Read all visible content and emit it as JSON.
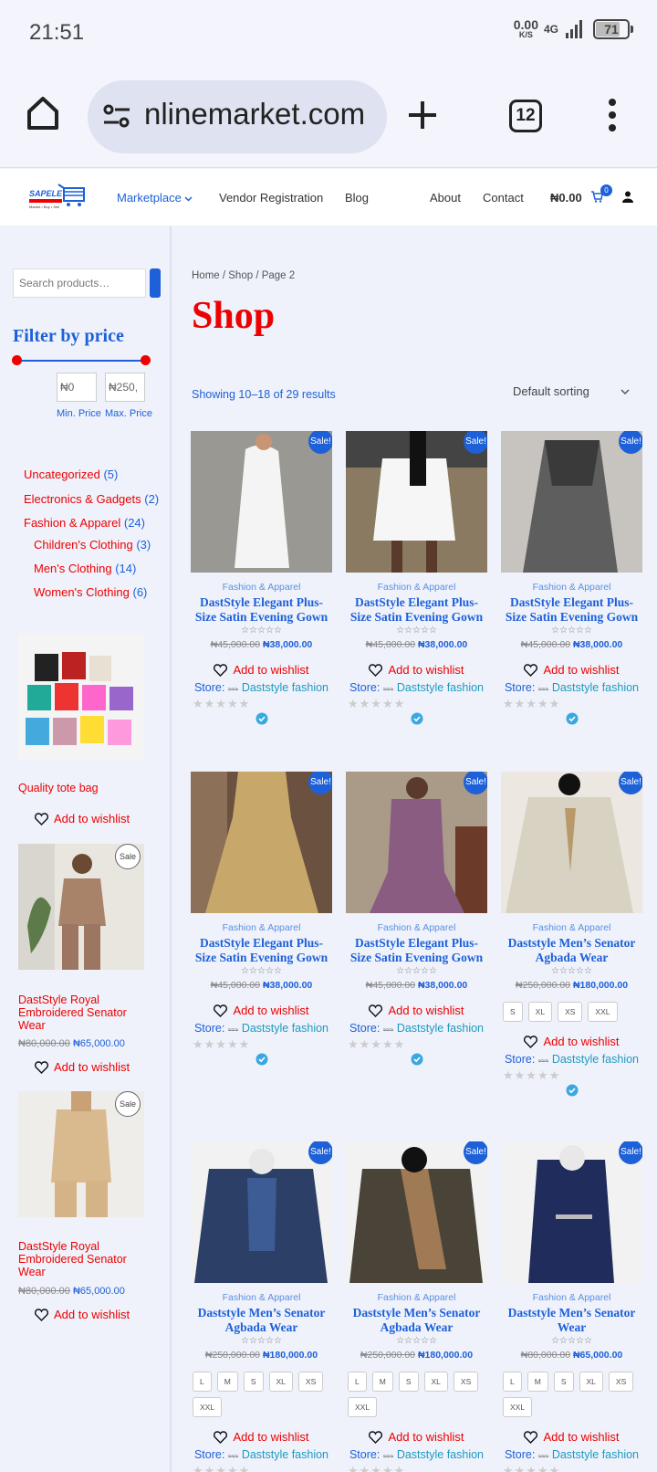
{
  "status": {
    "time": "21:51",
    "net_speed": "0.00",
    "net_unit": "K/S",
    "network": "4G",
    "battery": "71"
  },
  "browser": {
    "url": "nlinemarket.com",
    "tab_count": "12"
  },
  "header": {
    "nav": [
      "Marketplace",
      "Vendor Registration",
      "Blog",
      "About",
      "Contact"
    ],
    "cart_amount": "₦0.00",
    "cart_count": "0",
    "logo_text": "SAPELE ONLINE MARKET"
  },
  "sidebar": {
    "search_placeholder": "Search products…",
    "filter_title": "Filter by price",
    "min_value": "₦0",
    "max_value": "₦250,",
    "min_label": "Min. Price",
    "max_label": "Max. Price",
    "categories": [
      {
        "name": "Uncategorized",
        "count": "(5)"
      },
      {
        "name": "Electronics & Gadgets",
        "count": "(2)"
      },
      {
        "name": "Fashion & Apparel",
        "count": "(24)"
      },
      {
        "name": "Children's Clothing",
        "count": "(3)"
      },
      {
        "name": "Men's Clothing",
        "count": "(14)"
      },
      {
        "name": "Women's Clothing",
        "count": "(6)"
      }
    ],
    "products": [
      {
        "title": "Quality tote bag",
        "wishlist": "Add to wishlist"
      },
      {
        "title": "DastStyle Royal Embroidered Senator Wear",
        "old_price": "₦80,000.00",
        "price": "₦65,000.00",
        "badge": "Sale",
        "wishlist": "Add to wishlist"
      },
      {
        "title": "DastStyle Royal Embroidered Senator Wear",
        "old_price": "₦80,000.00",
        "price": "₦65,000.00",
        "badge": "Sale",
        "wishlist": "Add to wishlist"
      }
    ]
  },
  "content": {
    "breadcrumb": "Home / Shop / Page 2",
    "title": "Shop",
    "showing": "Showing 10–18 of 29 results",
    "sorting": "Default sorting",
    "products": [
      {
        "category": "Fashion & Apparel",
        "title": "DastStyle Elegant Plus-Size Satin Evening Gown",
        "old_price": "₦45,000.00",
        "price": "₦38,000.00",
        "badge": "Sale!",
        "wishlist": "Add to wishlist",
        "store_label": "Store:",
        "store": "Daststyle fashion"
      },
      {
        "category": "Fashion & Apparel",
        "title": "DastStyle Elegant Plus-Size Satin Evening Gown",
        "old_price": "₦45,000.00",
        "price": "₦38,000.00",
        "badge": "Sale!",
        "wishlist": "Add to wishlist",
        "store_label": "Store:",
        "store": "Daststyle fashion"
      },
      {
        "category": "Fashion & Apparel",
        "title": "DastStyle Elegant Plus-Size Satin Evening Gown",
        "old_price": "₦45,000.00",
        "price": "₦38,000.00",
        "badge": "Sale!",
        "wishlist": "Add to wishlist",
        "store_label": "Store:",
        "store": "Daststyle fashion"
      },
      {
        "category": "Fashion & Apparel",
        "title": "DastStyle Elegant Plus-Size Satin Evening Gown",
        "old_price": "₦45,000.00",
        "price": "₦38,000.00",
        "badge": "Sale!",
        "wishlist": "Add to wishlist",
        "store_label": "Store:",
        "store": "Daststyle fashion"
      },
      {
        "category": "Fashion & Apparel",
        "title": "DastStyle Elegant Plus-Size Satin Evening Gown",
        "old_price": "₦45,000.00",
        "price": "₦38,000.00",
        "badge": "Sale!",
        "wishlist": "Add to wishlist",
        "store_label": "Store:",
        "store": "Daststyle fashion"
      },
      {
        "category": "Fashion & Apparel",
        "title": "Daststyle Men’s Senator Agbada Wear",
        "old_price": "₦250,000.00",
        "price": "₦180,000.00",
        "badge": "Sale!",
        "sizes": [
          "S",
          "XL",
          "XS",
          "XXL"
        ],
        "wishlist": "Add to wishlist",
        "store_label": "Store:",
        "store": "Daststyle fashion"
      },
      {
        "category": "Fashion & Apparel",
        "title": "Daststyle Men’s Senator Agbada Wear",
        "old_price": "₦250,000.00",
        "price": "₦180,000.00",
        "badge": "Sale!",
        "sizes": [
          "L",
          "M",
          "S",
          "XL",
          "XS",
          "XXL"
        ],
        "wishlist": "Add to wishlist",
        "store_label": "Store:",
        "store": "Daststyle fashion"
      },
      {
        "category": "Fashion & Apparel",
        "title": "Daststyle Men’s Senator Agbada Wear",
        "old_price": "₦250,000.00",
        "price": "₦180,000.00",
        "badge": "Sale!",
        "sizes": [
          "L",
          "M",
          "S",
          "XL",
          "XS",
          "XXL"
        ],
        "wishlist": "Add to wishlist",
        "store_label": "Store:",
        "store": "Daststyle fashion"
      },
      {
        "category": "Fashion & Apparel",
        "title": "Daststyle Men’s Senator Wear",
        "old_price": "₦80,000.00",
        "price": "₦65,000.00",
        "badge": "Sale!",
        "sizes": [
          "L",
          "M",
          "S",
          "XL",
          "XS",
          "XXL"
        ],
        "wishlist": "Add to wishlist",
        "store_label": "Store:",
        "store": "Daststyle fashion"
      }
    ]
  },
  "colors": {
    "accent": "#1d60d8",
    "sale_red": "#e00000",
    "store_teal": "#1d9ac0"
  },
  "icons": [
    "home-icon",
    "site-settings-icon",
    "new-tab-icon",
    "tabs-icon",
    "more-icon",
    "cart-icon",
    "user-icon",
    "heart-icon",
    "verified-icon",
    "star-icon",
    "chevron-down-icon"
  ]
}
